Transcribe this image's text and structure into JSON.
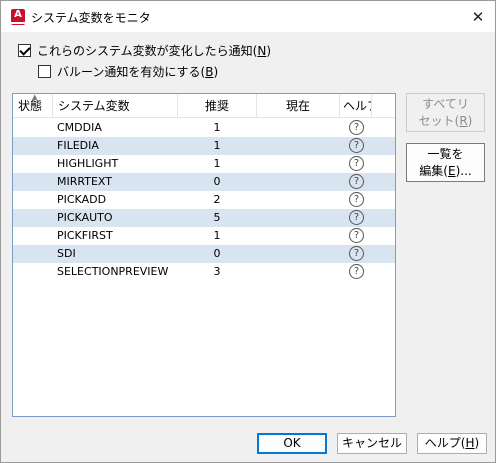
{
  "window": {
    "title": "システム変数をモニタ",
    "app_icon_letter": "A"
  },
  "options": {
    "notify_label": "これらのシステム変数が変化したら通知(",
    "notify_mnemonic": "N",
    "notify_tail": ")",
    "notify_checked": true,
    "balloon_label": "バルーン通知を有効にする(",
    "balloon_mnemonic": "B",
    "balloon_tail": ")",
    "balloon_checked": false
  },
  "table": {
    "columns": [
      "状態",
      "システム変数",
      "推奨",
      "現在",
      "ヘルプ"
    ],
    "rows": [
      {
        "name": "CMDDIA",
        "recommended": "1",
        "current": "",
        "help": "?"
      },
      {
        "name": "FILEDIA",
        "recommended": "1",
        "current": "",
        "help": "?"
      },
      {
        "name": "HIGHLIGHT",
        "recommended": "1",
        "current": "",
        "help": "?"
      },
      {
        "name": "MIRRTEXT",
        "recommended": "0",
        "current": "",
        "help": "?"
      },
      {
        "name": "PICKADD",
        "recommended": "2",
        "current": "",
        "help": "?"
      },
      {
        "name": "PICKAUTO",
        "recommended": "5",
        "current": "",
        "help": "?"
      },
      {
        "name": "PICKFIRST",
        "recommended": "1",
        "current": "",
        "help": "?"
      },
      {
        "name": "SDI",
        "recommended": "0",
        "current": "",
        "help": "?"
      },
      {
        "name": "SELECTIONPREVIEW",
        "recommended": "3",
        "current": "",
        "help": "?"
      }
    ]
  },
  "side_buttons": {
    "reset_line1": "すべてリ",
    "reset_line2": "セット(",
    "reset_mnemonic": "R",
    "reset_tail": ")",
    "edit_line1": "一覧を",
    "edit_line2": "編集(",
    "edit_mnemonic": "E",
    "edit_tail": ")..."
  },
  "footer": {
    "ok": "OK",
    "cancel": "キャンセル",
    "help": "ヘルプ(",
    "help_mnemonic": "H",
    "help_tail": ")"
  },
  "colors": {
    "row_alt": "#d9e4f1",
    "default_button_border": "#0078d4",
    "icon_red": "#c8102e"
  }
}
